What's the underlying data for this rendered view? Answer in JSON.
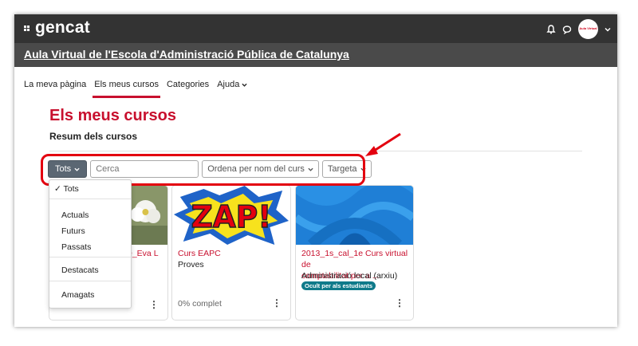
{
  "header": {
    "logo_text": "gencat",
    "icons": [
      "bell-icon",
      "chat-icon"
    ],
    "avatar_text": "Aula Virtual"
  },
  "site": {
    "title": "Aula Virtual de l'Escola d'Administració Pública de Catalunya"
  },
  "nav": {
    "items": [
      "La meva pàgina",
      "Els meus cursos",
      "Categories",
      "Ajuda"
    ],
    "active_index": 1
  },
  "page": {
    "title": "Els meus cursos",
    "section": "Resum dels cursos"
  },
  "controls": {
    "filter_label": "Tots",
    "search_placeholder": "Cerca",
    "sort_label": "Ordena per nom del curs",
    "view_label": "Targeta"
  },
  "dropdown": {
    "selected": "Tots",
    "items": [
      "Tots",
      "Actuals",
      "Futurs",
      "Passats",
      "Destacats",
      "Amagats"
    ]
  },
  "courses": [
    {
      "name": "e_Eva L",
      "category": "",
      "progress": ""
    },
    {
      "name": "Curs EAPC",
      "category": "Proves",
      "progress": "0% complet"
    },
    {
      "name_line1": "2013_1s_cal_1e Curs virtual de",
      "name_line2": "comptabilitat per a ...",
      "category": "Administració local (arxiu)",
      "badge": "Ocult per als estudiants"
    }
  ],
  "colors": {
    "brand_red": "#c8102e",
    "topbar": "#333333",
    "sitebar": "#4a4a4a",
    "badge": "#0f7a8a",
    "highlight": "#e3000f"
  }
}
